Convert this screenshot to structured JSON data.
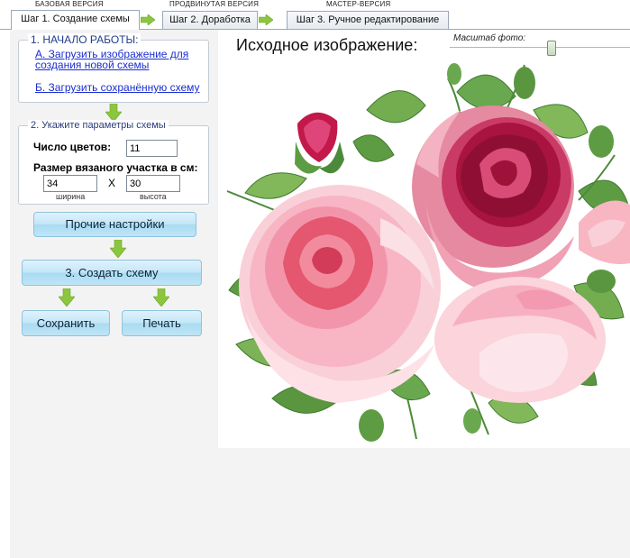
{
  "versions": {
    "basic": "БАЗОВАЯ ВЕРСИЯ",
    "advanced": "ПРОДВИНУТАЯ ВЕРСИЯ",
    "master": "МАСТЕР-ВЕРСИЯ"
  },
  "tabs": [
    {
      "label": "Шаг 1. Создание схемы",
      "active": true
    },
    {
      "label": "Шаг 2. Доработка",
      "active": false
    },
    {
      "label": "Шаг 3. Ручное редактирование",
      "active": false
    }
  ],
  "start_group": {
    "title": "1. НАЧАЛО РАБОТЫ:",
    "link_a_line1": "А. Загрузить изображение для",
    "link_a_line2": "создания новой схемы",
    "link_b": "Б. Загрузить сохранённую схему"
  },
  "params_group": {
    "title": "2. Укажите параметры схемы",
    "colors_label": "Число цветов:",
    "colors_value": "11",
    "size_label": "Размер вязаного участка в см:",
    "width_value": "34",
    "height_value": "30",
    "x_label": "X",
    "width_caption": "ширина",
    "height_caption": "высота"
  },
  "buttons": {
    "other_settings": "Прочие настройки",
    "create_scheme": "3. Создать схему",
    "save": "Сохранить",
    "print": "Печать"
  },
  "preview": {
    "title": "Исходное изображение:",
    "scale_label": "Масштаб фото:"
  },
  "colors": {
    "accent_green": "#8cc63f",
    "button_blue": "#bfe5f6",
    "link_blue": "#1a2ed0",
    "panel_gray": "#f3f3f3"
  }
}
